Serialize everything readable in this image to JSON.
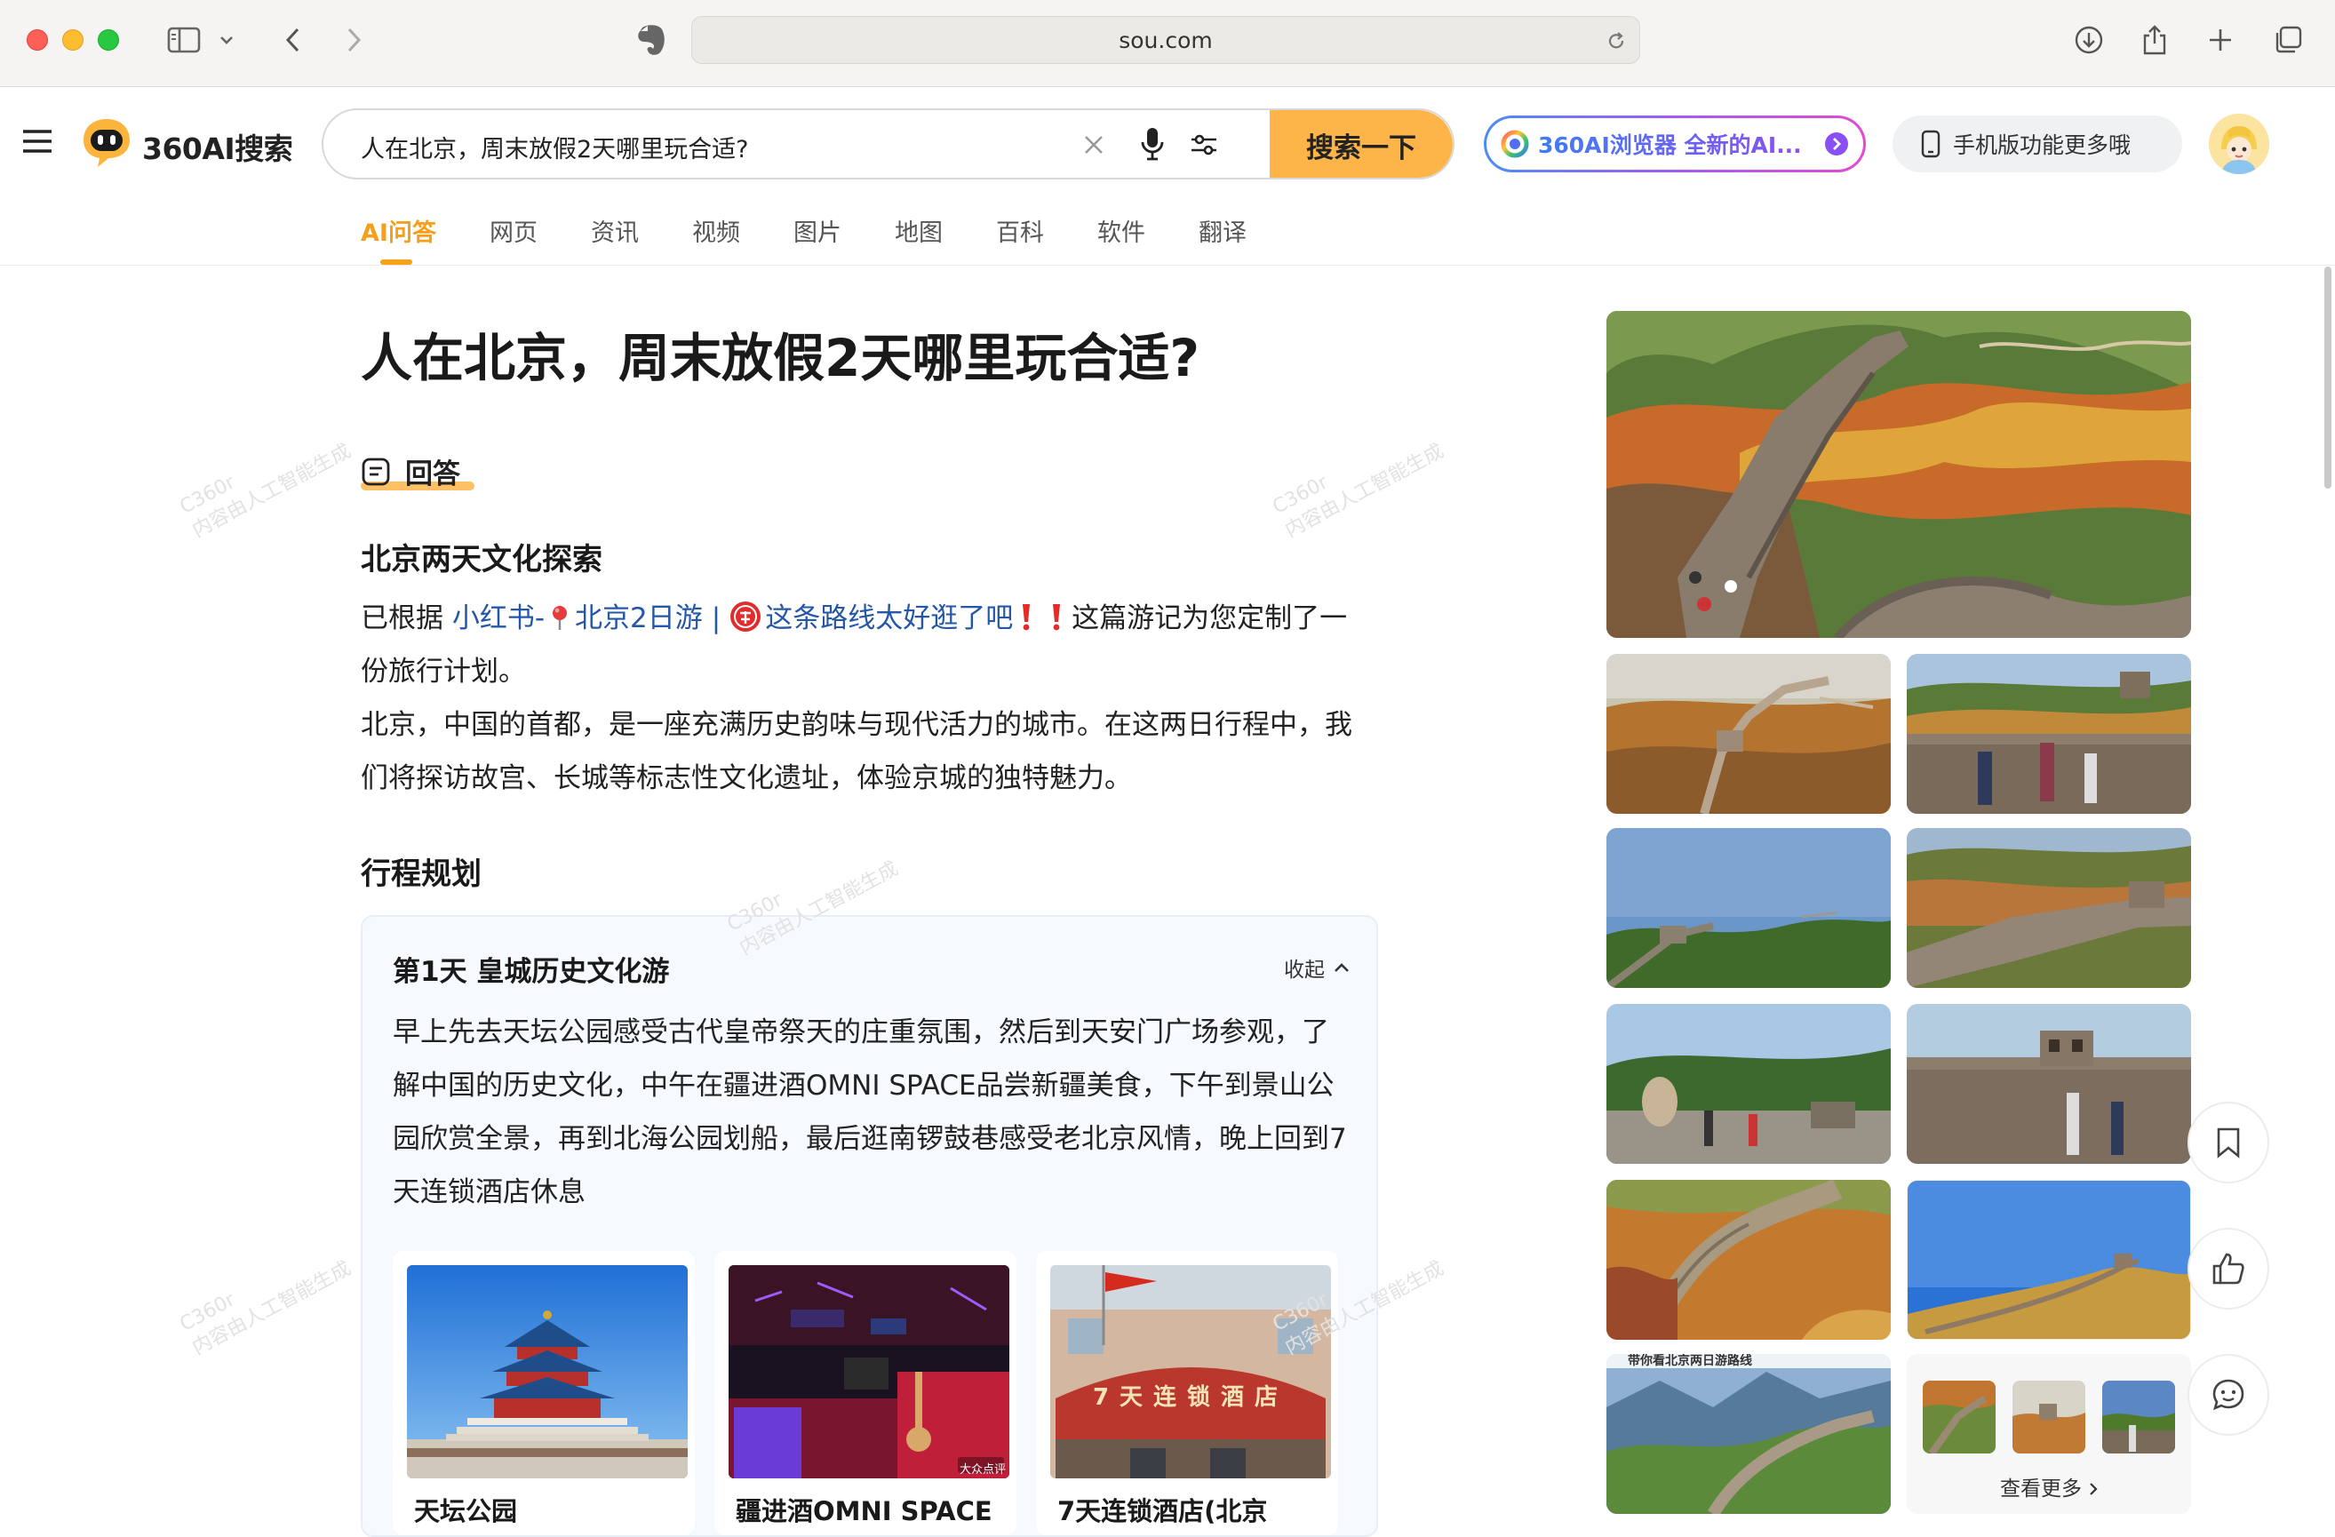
{
  "browser": {
    "url": "sou.com"
  },
  "site": {
    "logo_text": "360AI搜索",
    "query": "人在北京，周末放假2天哪里玩合适?",
    "search_button": "搜索一下",
    "ai_browser_promo": "360AI浏览器 全新的AI...",
    "mobile_promo": "手机版功能更多哦"
  },
  "tabs": [
    "AI问答",
    "网页",
    "资讯",
    "视频",
    "图片",
    "地图",
    "百科",
    "软件",
    "翻译"
  ],
  "active_tab": "AI问答",
  "main": {
    "title": "人在北京，周末放假2天哪里玩合适?",
    "answer_label": "回答",
    "section1_heading": "北京两天文化探索",
    "intro_prefix": "已根据 ",
    "intro_link1": "小红书-",
    "intro_link2": "北京2日游",
    "intro_sep": "|",
    "intro_link3": "这条路线太好逛了吧",
    "intro_suffix": " 这篇游记为您定制了一份旅行计划。",
    "intro_para2": "北京，中国的首都，是一座充满历史韵味与现代活力的城市。在这两日行程中，我们将探访故宫、长城等标志性文化遗址，体验京城的独特魅力。",
    "section2_heading": "行程规划",
    "day1": {
      "title": "第1天 皇城历史文化游",
      "collapse": "收起",
      "description": "早上先去天坛公园感受古代皇帝祭天的庄重氛围，然后到天安门广场参观，了解中国的历史文化，中午在疆进酒OMNI SPACE品尝新疆美食，下午到景山公园欣赏全景，再到北海公园划船，最后逛南锣鼓巷感受老北京风情，晚上回到7天连锁酒店休息",
      "places": [
        "天坛公园",
        "疆进酒OMNI SPACE",
        "7天连锁酒店(北京"
      ]
    },
    "watermark": [
      "C360r",
      "内容由人工智能生成"
    ],
    "image_overlay_badge": "大众点评",
    "sign_text": "7天连锁酒店"
  },
  "gallery": {
    "caption": "带你看北京两日游路线",
    "more_label": "查看更多"
  },
  "colors": {
    "accent": "#fdb54a",
    "active_tab": "#f59f1a",
    "link": "#2557a8",
    "card_bg": "#f6f9fd"
  },
  "icons": [
    "menu-icon",
    "logo-icon",
    "clear-icon",
    "mic-icon",
    "filter-icon",
    "phone-icon",
    "bookmark-icon",
    "thumb-up-icon",
    "chat-icon",
    "chevron-up-icon",
    "chevron-right-icon",
    "pin-icon",
    "secret-icon",
    "exclamation-icon"
  ]
}
